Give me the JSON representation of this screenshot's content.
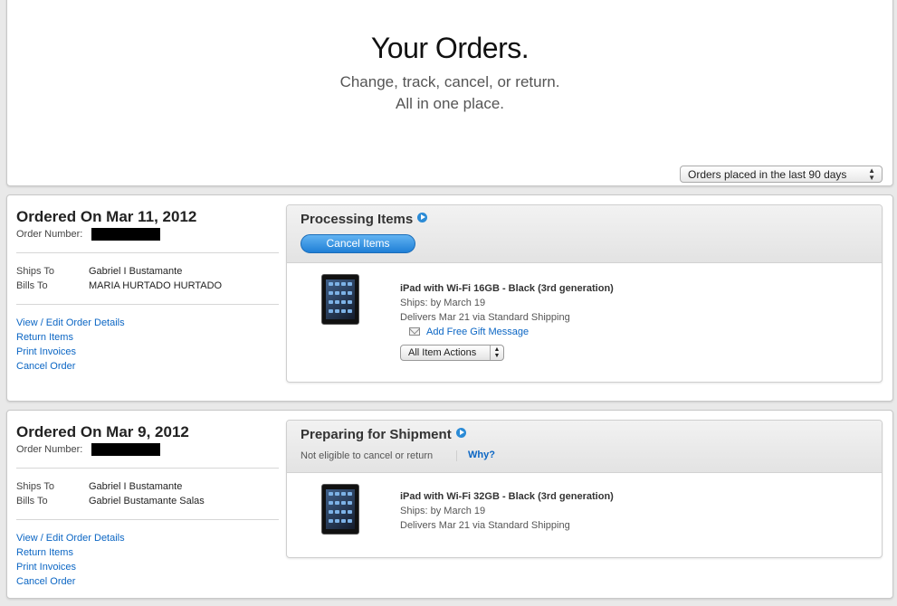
{
  "hero": {
    "title": "Your Orders.",
    "subtitle_1": "Change, track, cancel, or return.",
    "subtitle_2": "All in one place.",
    "filter": "Orders placed in the last 90 days"
  },
  "orders": [
    {
      "ordered_on": "Ordered On Mar 11, 2012",
      "order_number_label": "Order Number:",
      "ships_to_label": "Ships To",
      "ships_to": "Gabriel I Bustamante",
      "bills_to_label": "Bills To",
      "bills_to": "MARIA HURTADO HURTADO",
      "links": [
        "View / Edit Order Details",
        "Return Items",
        "Print Invoices",
        "Cancel Order"
      ],
      "status": "Processing Items",
      "cancel_button": "Cancel Items",
      "item": {
        "name": "iPad with Wi-Fi 16GB - Black (3rd generation)",
        "ships": "Ships:  by March 19",
        "delivers": "Delivers  Mar 21 via Standard Shipping",
        "gift_message": "Add Free Gift Message",
        "actions": "All Item Actions"
      }
    },
    {
      "ordered_on": "Ordered On Mar 9, 2012",
      "order_number_label": "Order Number:",
      "ships_to_label": "Ships To",
      "ships_to": "Gabriel I Bustamante",
      "bills_to_label": "Bills To",
      "bills_to": "Gabriel Bustamante Salas",
      "links": [
        "View / Edit Order Details",
        "Return Items",
        "Print Invoices",
        "Cancel Order"
      ],
      "status": "Preparing for Shipment",
      "note": "Not eligible to cancel or return",
      "why": "Why?",
      "item": {
        "name": "iPad with Wi-Fi 32GB - Black (3rd generation)",
        "ships": "Ships:  by March 19",
        "delivers": "Delivers  Mar 21 via Standard Shipping"
      }
    }
  ],
  "colors": {
    "link": "#0b66c4",
    "button": "#1f7fd6",
    "background": "#e9e9e9"
  },
  "icons": [
    "play-arrow-icon",
    "gift-envelope-icon",
    "select-arrows-icon",
    "ipad-product-image"
  ]
}
